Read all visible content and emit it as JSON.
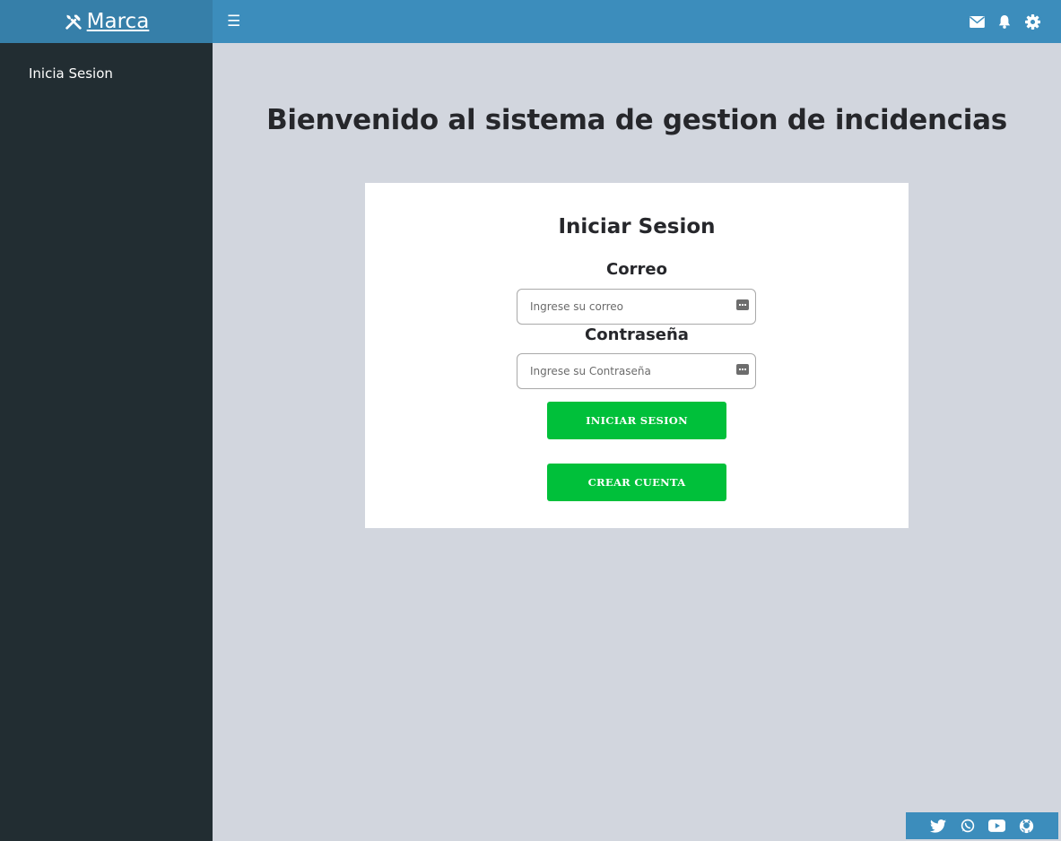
{
  "brand": {
    "name": "Marca",
    "icon": "tools-icon"
  },
  "sidebar": {
    "items": [
      {
        "label": "Inicia Sesion"
      }
    ]
  },
  "topbar": {
    "menu_toggle": "☰",
    "icons": [
      "envelope-icon",
      "bell-icon",
      "gear-icon"
    ]
  },
  "main": {
    "title": "Bienvenido al sistema de gestion de incidencias",
    "login": {
      "title": "Iniciar Sesion",
      "email_label": "Correo",
      "email_placeholder": "Ingrese su correo",
      "password_label": "Contraseña",
      "password_placeholder": "Ingrese su Contraseña",
      "login_button": "INICIAR SESION",
      "register_button": "CREAR CUENTA"
    }
  },
  "footer": {
    "social_icons": [
      "twitter-icon",
      "whatsapp-icon",
      "youtube-icon",
      "github-icon"
    ]
  },
  "colors": {
    "header_brand_bg": "#367fa9",
    "topbar_bg": "#3c8dbc",
    "sidebar_bg": "#222d32",
    "content_bg": "#d2d6de",
    "button_green": "#00c03a"
  }
}
